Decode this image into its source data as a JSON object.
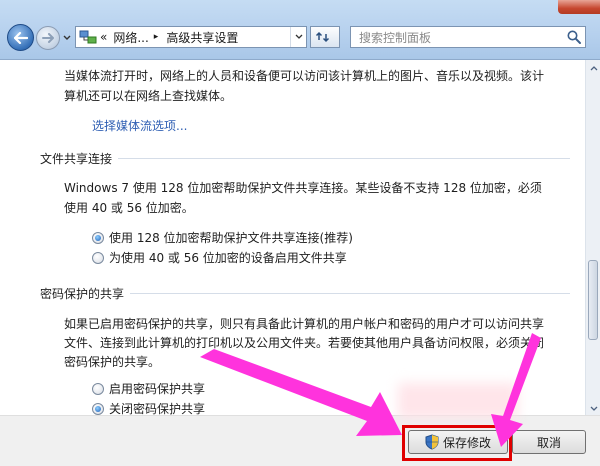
{
  "address": {
    "back_symbol": "«",
    "crumb1": "网络...",
    "separator": "▸",
    "crumb2": "高级共享设置"
  },
  "search": {
    "placeholder": "搜索控制面板"
  },
  "media": {
    "desc_line1": "当媒体流打开时，网络上的人员和设备便可以访问该计算机上的图片、音乐以及视频。该计",
    "desc_line2": "算机还可以在网络上查找媒体。",
    "link": "选择媒体流选项..."
  },
  "file_sharing": {
    "title": "文件共享连接",
    "desc_line1": "Windows 7 使用 128 位加密帮助保护文件共享连接。某些设备不支持 128 位加密，必须",
    "desc_line2": "使用 40 或 56 位加密。",
    "option1": "使用 128 位加密帮助保护文件共享连接(推荐)",
    "option2": "为使用 40 或 56 位加密的设备启用文件共享",
    "selected": "option1"
  },
  "password_sharing": {
    "title": "密码保护的共享",
    "desc_line1": "如果已启用密码保护的共享，则只有具备此计算机的用户帐户和密码的用户才可以访问共享",
    "desc_line2": "文件、连接到此计算机的打印机以及公用文件夹。若要使其他用户具备访问权限，必须关闭",
    "desc_line3": "密码保护的共享。",
    "option1": "启用密码保护共享",
    "option2": "关闭密码保护共享",
    "selected": "option2"
  },
  "footer": {
    "save_label": "保存修改",
    "cancel_label": "取消"
  },
  "colors": {
    "highlight": "#e00000",
    "arrow": "#ff33dd",
    "link": "#2f5fb3"
  }
}
